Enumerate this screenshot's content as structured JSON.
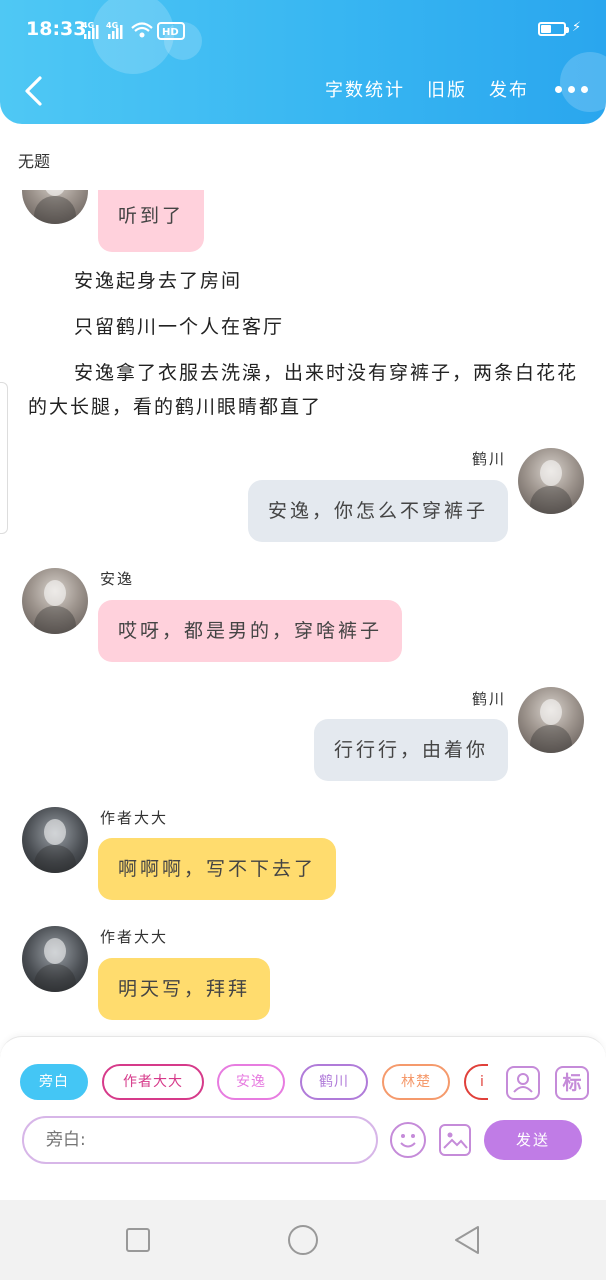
{
  "status": {
    "time": "18:33",
    "signal_1": "4G",
    "signal_2": "4G",
    "hd": "HD",
    "battery_level": 0.45
  },
  "header": {
    "actions": [
      "字数统计",
      "旧版",
      "发布"
    ]
  },
  "document": {
    "title": "无题"
  },
  "chat": {
    "top_cut_message": "听到了",
    "narration": [
      "安逸起身去了房间",
      "只留鹤川一个人在客厅",
      "安逸拿了衣服去洗澡，出来时没有穿裤子，两条白花花的大长腿，看的鹤川眼睛都直了"
    ],
    "messages": [
      {
        "speaker": "鹤川",
        "text": "安逸，你怎么不穿裤子"
      },
      {
        "speaker": "安逸",
        "text": "哎呀，都是男的，穿啥裤子"
      },
      {
        "speaker": "鹤川",
        "text": "行行行，由着你"
      },
      {
        "speaker": "作者大大",
        "text": "啊啊啊，写不下去了"
      },
      {
        "speaker": "作者大大",
        "text": "明天写，拜拜"
      }
    ]
  },
  "composer": {
    "roles": [
      "旁白",
      "作者大大",
      "安逸",
      "鹤川",
      "林楚",
      "i"
    ],
    "role_colors": {
      "narrator_fill": "#44c6f5",
      "author": "#d63a8a",
      "anyi": "#e77ce0",
      "hechuan": "#b07bd9",
      "linchu": "#f59a6c"
    },
    "tag_icon_label": "标",
    "input_placeholder": "旁白:",
    "send_label": "发送",
    "accent": "#c07ce6"
  },
  "colors": {
    "header": "#38b6f2",
    "bubble_pink": "#ffd1dc",
    "bubble_gray": "#e4e9ef",
    "bubble_yellow": "#ffdc6e"
  }
}
